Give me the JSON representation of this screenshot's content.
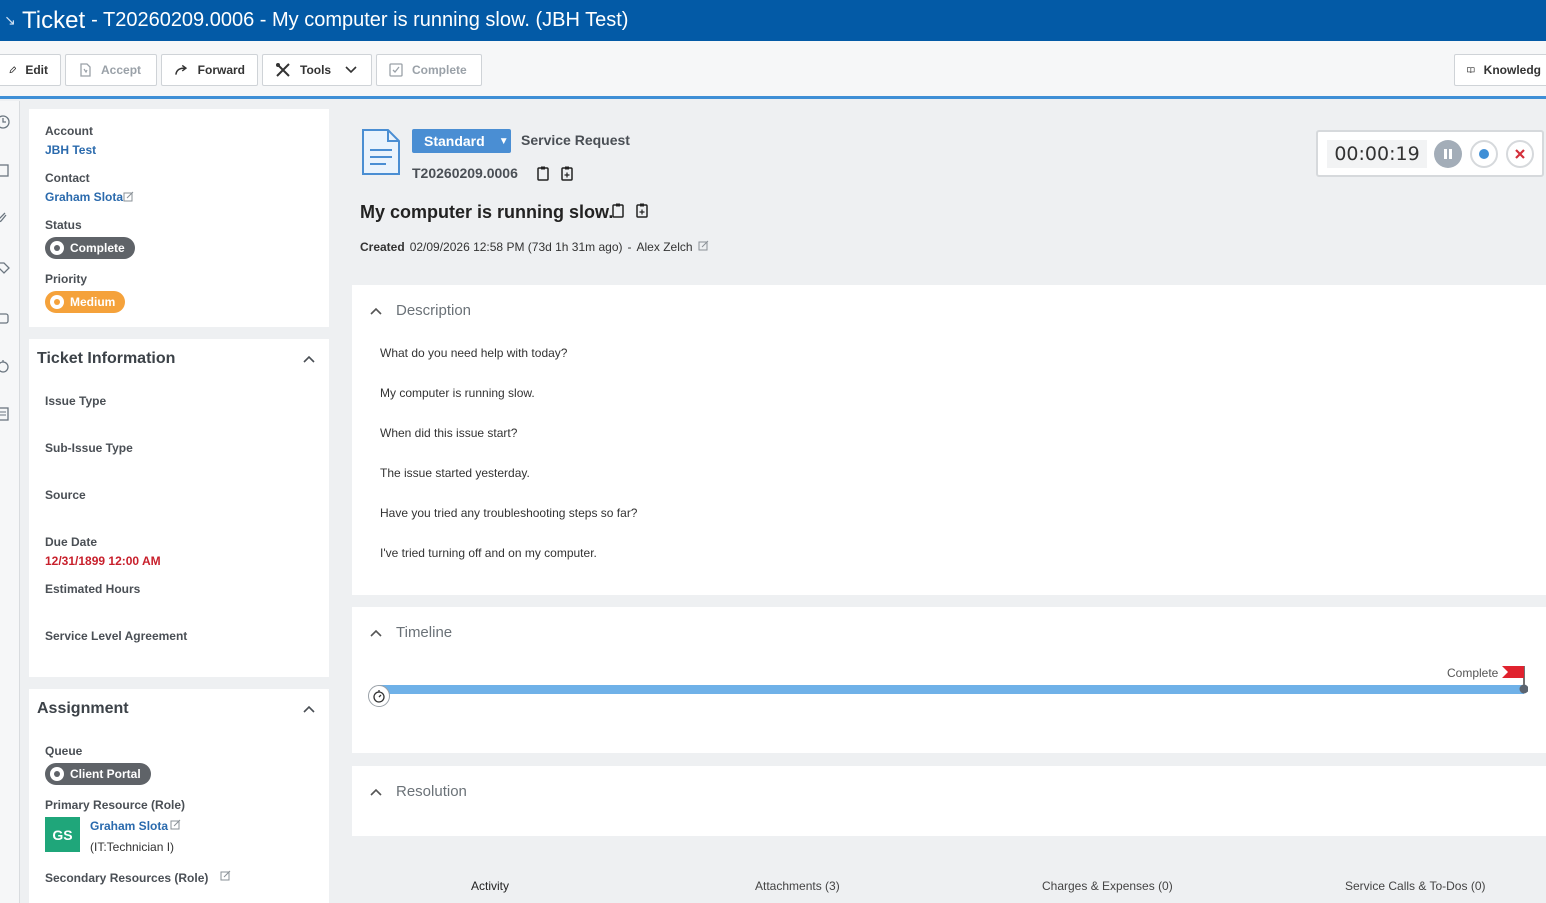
{
  "header": {
    "title": "Ticket",
    "subtitle": "- T20260209.0006 - My computer is running slow. (JBH Test)",
    "back_icon": "collapse-arrow-icon"
  },
  "toolbar": {
    "edit": "Edit",
    "accept": "Accept",
    "forward": "Forward",
    "tools": "Tools",
    "complete": "Complete",
    "knowledge": "Knowledg"
  },
  "summary": {
    "account_label": "Account",
    "account_value": "JBH Test",
    "contact_label": "Contact",
    "contact_value": "Graham Slota",
    "status_label": "Status",
    "status_value": "Complete",
    "priority_label": "Priority",
    "priority_value": "Medium"
  },
  "ticket_info": {
    "title": "Ticket Information",
    "issue_type": "Issue Type",
    "sub_issue_type": "Sub-Issue Type",
    "source": "Source",
    "due_date_label": "Due Date",
    "due_date_value": "12/31/1899 12:00 AM",
    "estimated_hours": "Estimated Hours",
    "sla": "Service Level Agreement"
  },
  "assignment": {
    "title": "Assignment",
    "queue_label": "Queue",
    "queue_value": "Client Portal",
    "primary_label": "Primary Resource (Role)",
    "avatar_initials": "GS",
    "primary_name": "Graham Slota",
    "primary_role": "(IT:Technician I)",
    "secondary_label": "Secondary Resources (Role)"
  },
  "ticket": {
    "type_button": "Standard",
    "category": "Service Request",
    "number": "T20260209.0006",
    "title": "My computer is running slow.",
    "created_label": "Created",
    "created_value": "02/09/2026 12:58 PM (73d 1h 31m ago)",
    "created_by_sep": "-",
    "created_by": "Alex Zelch"
  },
  "timer": {
    "value": "00:00:19"
  },
  "description": {
    "title": "Description",
    "lines": [
      "What do you need help with today?",
      "My computer is running slow.",
      "When did this issue start?",
      "The issue started yesterday.",
      "Have you tried any troubleshooting steps so far?",
      "I've tried turning off and on my computer."
    ]
  },
  "timeline": {
    "title": "Timeline",
    "end_label": "Complete",
    "progress_fraction": 1.0
  },
  "resolution": {
    "title": "Resolution"
  },
  "tabs": {
    "activity": "Activity",
    "attachments": "Attachments (3)",
    "charges": "Charges & Expenses (0)",
    "service_calls": "Service Calls & To-Dos (0)"
  },
  "colors": {
    "header_bg": "#035aa6",
    "accent_blue": "#3f8fd6",
    "status_gray": "#5f6368",
    "priority_orange": "#f5a23b",
    "link_blue": "#2a6aad",
    "due_red": "#c8202c",
    "avatar_green": "#1fa67a",
    "timeline_blue": "#6fb1e8",
    "flag_red": "#e0222e"
  }
}
